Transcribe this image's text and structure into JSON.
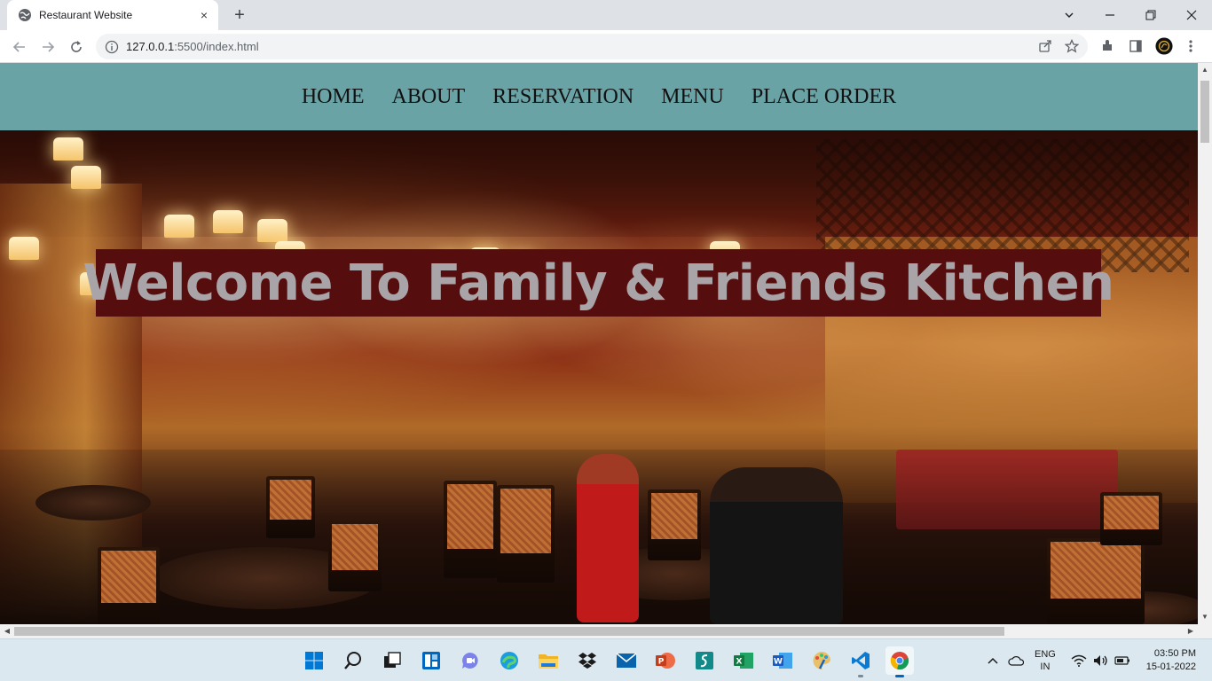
{
  "browser": {
    "tab_title": "Restaurant Website",
    "url_host": "127.0.0.1",
    "url_rest": ":5500/index.html",
    "tab_close": "×",
    "new_tab": "+"
  },
  "site": {
    "nav": [
      "HOME",
      "ABOUT",
      "RESERVATION",
      "MENU",
      "PLACE ORDER"
    ],
    "hero_title": "Welcome To Family & Friends Kitchen",
    "colors": {
      "nav_bg": "#6aa3a6",
      "title_bg": "#560d0d",
      "title_text": "#a9a4a8"
    }
  },
  "taskbar": {
    "apps": [
      "start-icon",
      "search-icon",
      "task-view-icon",
      "widgets-icon",
      "teams-chat-icon",
      "edge-icon",
      "file-explorer-icon",
      "dropbox-icon",
      "mail-icon",
      "powerpoint-icon",
      "sway-icon",
      "excel-icon",
      "word-icon",
      "paint-icon",
      "vscode-icon",
      "chrome-icon"
    ],
    "lang_top": "ENG",
    "lang_bottom": "IN",
    "time": "03:50 PM",
    "date": "15-01-2022"
  }
}
